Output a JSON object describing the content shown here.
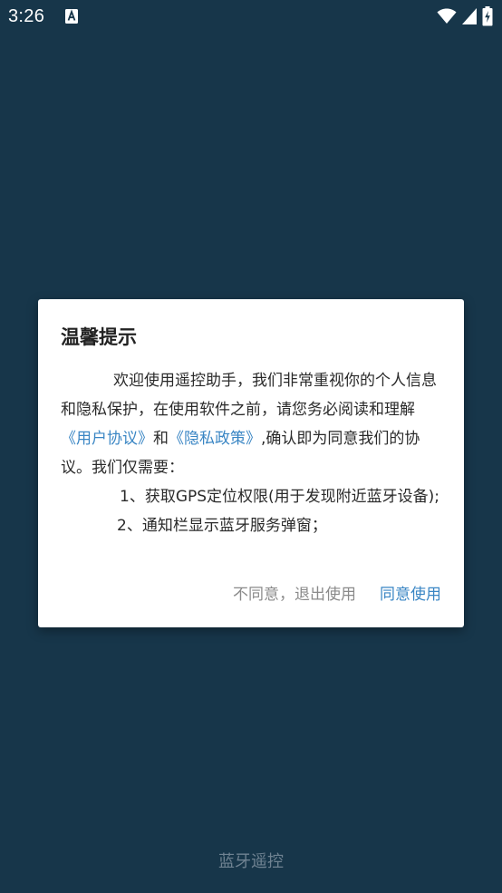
{
  "status_bar": {
    "time": "3:26",
    "notification_icon": "font-a-icon",
    "wifi_icon": "wifi-icon",
    "signal_icon": "cell-signal-icon",
    "battery_icon": "battery-charging-icon"
  },
  "dialog": {
    "title": "温馨提示",
    "body": {
      "p1_prefix": "欢迎使用遥控助手，我们非常重视你的个人信息和隐私保护，在使用软件之前，请您务必阅读和理解",
      "link_user_agreement": "《用户协议》",
      "and_text": "和",
      "link_privacy_policy": "《隐私政策》",
      "p1_suffix": ",确认即为同意我们的协议。我们仅需要：",
      "item1": "1、获取GPS定位权限(用于发现附近蓝牙设备);",
      "item2": "2、通知栏显示蓝牙服务弹窗；"
    },
    "buttons": {
      "disagree": "不同意，退出使用",
      "agree": "同意使用"
    }
  },
  "footer": {
    "app_name": "蓝牙遥控"
  },
  "colors": {
    "background": "#17364a",
    "link": "#3a86c4",
    "disagree_text": "#8a8a8a",
    "footer_text": "#6f8291"
  }
}
